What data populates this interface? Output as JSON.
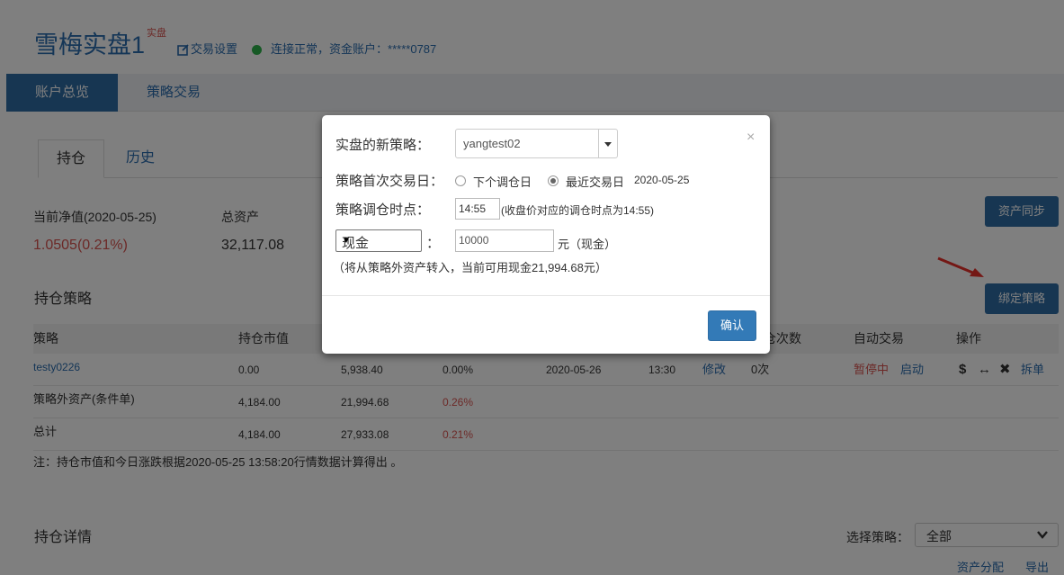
{
  "account": {
    "title": "雪梅实盘1",
    "tag": "实盘",
    "settings_label": "交易设置",
    "status_text": "连接正常，资金账户：*****0787"
  },
  "nav": {
    "overview": "账户总览",
    "strategy_trade": "策略交易"
  },
  "tabs": {
    "holdings": "持仓",
    "history": "历史"
  },
  "metrics": {
    "nav_label": "当前净值(2020-05-25)",
    "nav_value": "1.0505(0.21%)",
    "total_label": "总资产",
    "total_value": "32,117.08"
  },
  "buttons": {
    "sync": "资产同步",
    "bind": "绑定策略"
  },
  "sections": {
    "holdings": "持仓策略",
    "details": "持仓详情"
  },
  "table": {
    "headers": [
      "策略",
      "持仓市值",
      "仓次数",
      "自动交易",
      "操作"
    ],
    "rows": [
      {
        "name": "testy0226",
        "c1": "0.00",
        "c2": "5,938.40",
        "c3": "0.00%",
        "date": "2020-05-26",
        "time": "13:30",
        "edit": "修改",
        "count": "0次",
        "auto_status": "暂停中",
        "auto_action": "启动",
        "ops": [
          "$",
          "↔",
          "✖"
        ],
        "split": "拆单"
      },
      {
        "name": "策略外资产(条件单)",
        "c1": "4,184.00",
        "c2": "21,994.68",
        "c3": "0.26%"
      },
      {
        "name": "总计",
        "c1": "4,184.00",
        "c2": "27,933.08",
        "c3": "0.21%"
      }
    ],
    "note": "注：持仓市值和今日涨跌根据2020-05-25 13:58:20行情数据计算得出 。"
  },
  "details": {
    "select_label": "选择策略：",
    "select_value": "全部",
    "links": {
      "allocation": "资产分配",
      "export": "导出"
    }
  },
  "modal": {
    "strategy_label": "实盘的新策略：",
    "strategy_value": "yangtest02",
    "first_trade_label": "策略首次交易日：",
    "option_next": "下个调仓日",
    "option_recent": "最近交易日",
    "recent_date": "2020-05-25",
    "rebalance_label": "策略调仓时点：",
    "rebalance_time": "14:55",
    "rebalance_hint": "(收盘价对应的调仓时点为14:55)",
    "cash_type": "现金",
    "cash_amount": "10000",
    "cash_unit": "元（现金）",
    "cash_hint": "（将从策略外资产转入，当前可用现金21,994.68元）",
    "close": "×",
    "confirm": "确认"
  },
  "colors": {
    "primary": "#2f6da5",
    "link": "#2a6cae",
    "danger": "#d9534f",
    "ok": "#2cb34a"
  }
}
